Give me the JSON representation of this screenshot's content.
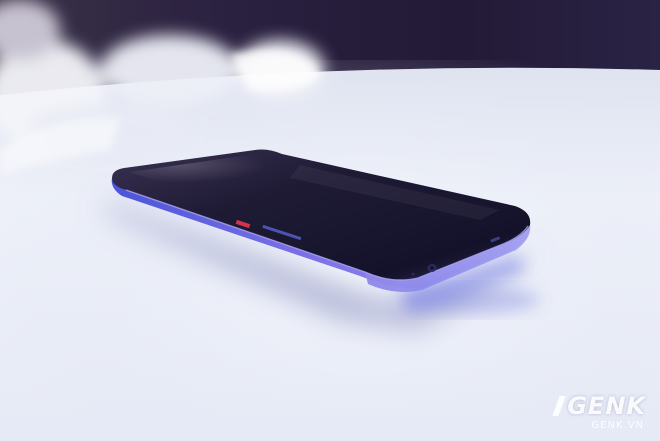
{
  "photo": {
    "subject": "smartphone",
    "colors": {
      "background_dark": "#231c3a",
      "table_surface": "#e9edf7",
      "phone_frame": "#6f6fd8",
      "phone_screen": "#1d1a33",
      "accent_red": "#d8324a"
    }
  },
  "watermark": {
    "brand": "GENK",
    "domain": "GENK.VN"
  }
}
